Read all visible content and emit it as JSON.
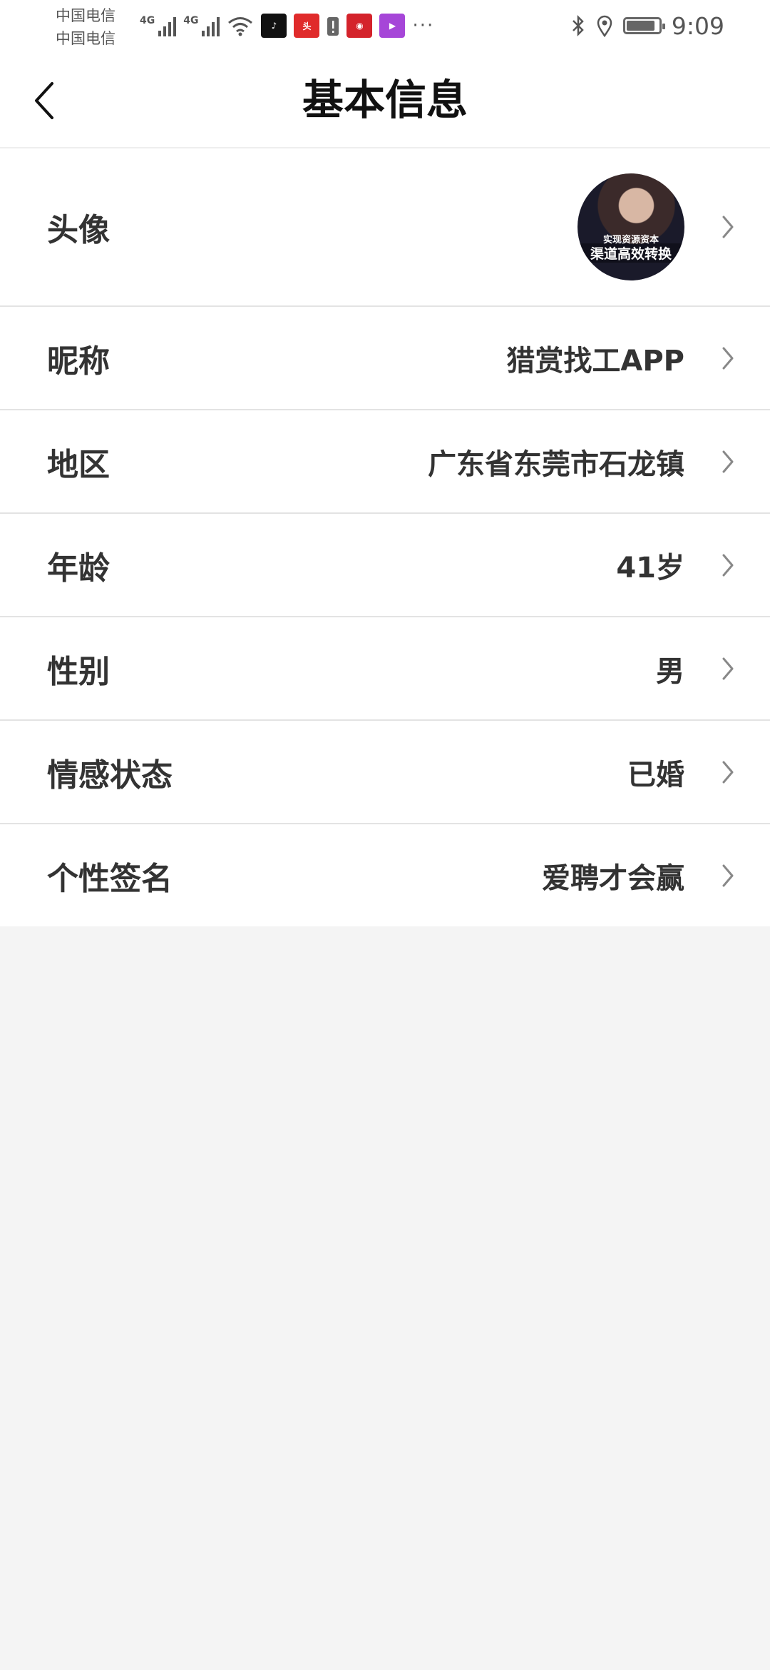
{
  "status_bar": {
    "carrier_1": "中国电信",
    "carrier_2": "中国电信",
    "network_1": "4G",
    "network_2": "4G",
    "time": "9:09",
    "app_icons": [
      "tiktok-icon",
      "toutiao-icon",
      "app-icon",
      "kuaishou-icon",
      "video-icon"
    ]
  },
  "header": {
    "title": "基本信息",
    "back_icon": "chevron-left-icon"
  },
  "profile": {
    "avatar_label": "头像",
    "avatar_caption_small": "实现资源资本",
    "avatar_caption_large": "渠道高效转换",
    "rows": [
      {
        "label": "昵称",
        "value": "猎赏找工APP"
      },
      {
        "label": "地区",
        "value": "广东省东莞市石龙镇"
      },
      {
        "label": "年龄",
        "value": "41岁"
      },
      {
        "label": "性别",
        "value": "男"
      },
      {
        "label": "情感状态",
        "value": "已婚"
      },
      {
        "label": "个性签名",
        "value": "爱聘才会赢"
      }
    ]
  },
  "colors": {
    "background": "#f4f4f4",
    "text": "#333333",
    "chevron": "#888888"
  }
}
